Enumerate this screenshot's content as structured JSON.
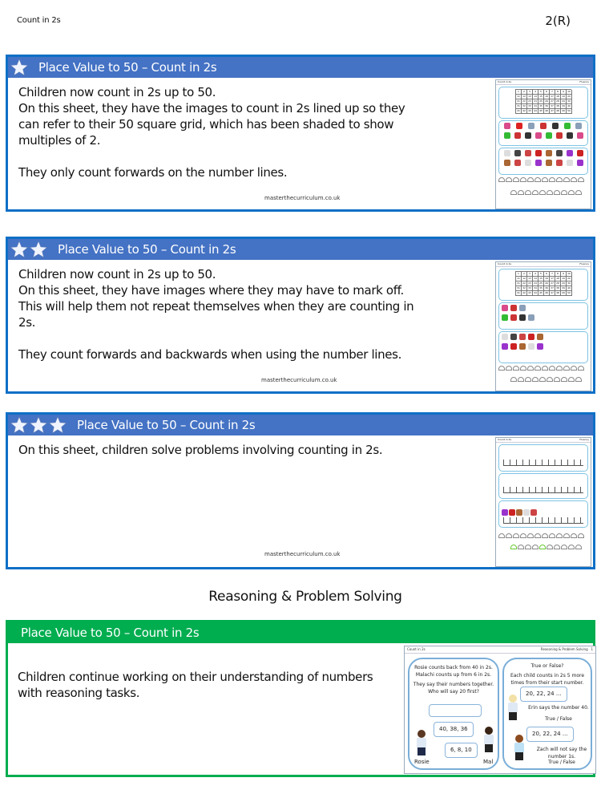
{
  "page": {
    "header_left": "Count in 2s",
    "header_right": "2(R)"
  },
  "colors": {
    "blue_border": "#0f6fc6",
    "blue_band": "#4472c4",
    "green": "#00ad4f"
  },
  "panels": [
    {
      "stars": 1,
      "star_icon": "star-icon",
      "title": "Place Value to 50 – Count in 2s",
      "description": "Children now count in 2s up to 50.\nOn this sheet, they have the images to count in 2s lined up so they\ncan refer to their 50 square grid, which has been shaded to show\nmultiples of 2.\n\nThey only count forwards on the number lines.",
      "credit": "masterthecurriculum.co.uk"
    },
    {
      "stars": 2,
      "star_icon": "star-icon",
      "title": "Place Value to 50 – Count in 2s",
      "description": "Children now count in 2s up to 50.\nOn this sheet, they have images where they may have to mark off.\nThis will help them not repeat themselves when they are counting in\n2s.\n\nThey count forwards and backwards when using the number lines.",
      "credit": "masterthecurriculum.co.uk"
    },
    {
      "stars": 3,
      "star_icon": "star-icon",
      "title": "Place Value to 50 – Count in 2s",
      "description": "On this sheet, children solve problems involving counting in 2s.",
      "credit": "masterthecurriculum.co.uk"
    }
  ],
  "reasoning": {
    "section_title": "Reasoning & Problem Solving",
    "title": "Place Value to 50 – Count in 2s",
    "description": "Children continue working on their understanding of numbers\nwith reasoning tasks.",
    "thumbnail": {
      "header_left": "Count in 2s",
      "header_right": "Reasoning & Problem Solving",
      "header_num": "1",
      "left_card": {
        "line1": "Rosie counts back from 40 in 2s.",
        "line2": "Malachi counts up from 6 in 2s.",
        "line3": "They say their numbers together.",
        "line4": "Who will say 20 first?",
        "bubble_rosie": "40, 38, 36",
        "bubble_mal": "6, 8, 10",
        "label_rosie": "Rosie",
        "label_mal": "Mal"
      },
      "right_card": {
        "title": "True or False?",
        "instruction": "Each child counts in 2s 5 more times from their start number.",
        "bubble_1": "20, 22, 24 ...",
        "statement_1": "Erin says the number 40.",
        "answer_1": "True / False",
        "bubble_2": "20, 22, 24 ...",
        "statement_2": "Zach will not say the number 1s.",
        "answer_2": "True / False"
      }
    }
  },
  "worksheet_thumbs": {
    "grid_numbers": [
      "1",
      "2",
      "3",
      "4",
      "5",
      "6",
      "7",
      "8",
      "9",
      "10",
      "11",
      "12",
      "13",
      "14",
      "15",
      "16",
      "17",
      "18",
      "19",
      "20",
      "21",
      "22",
      "23",
      "24",
      "25",
      "26",
      "27",
      "28",
      "29",
      "30",
      "31",
      "32",
      "33",
      "34",
      "35",
      "36",
      "37",
      "38",
      "39",
      "40",
      "41",
      "42",
      "43",
      "44",
      "45",
      "46",
      "47",
      "48",
      "49",
      "50"
    ]
  }
}
